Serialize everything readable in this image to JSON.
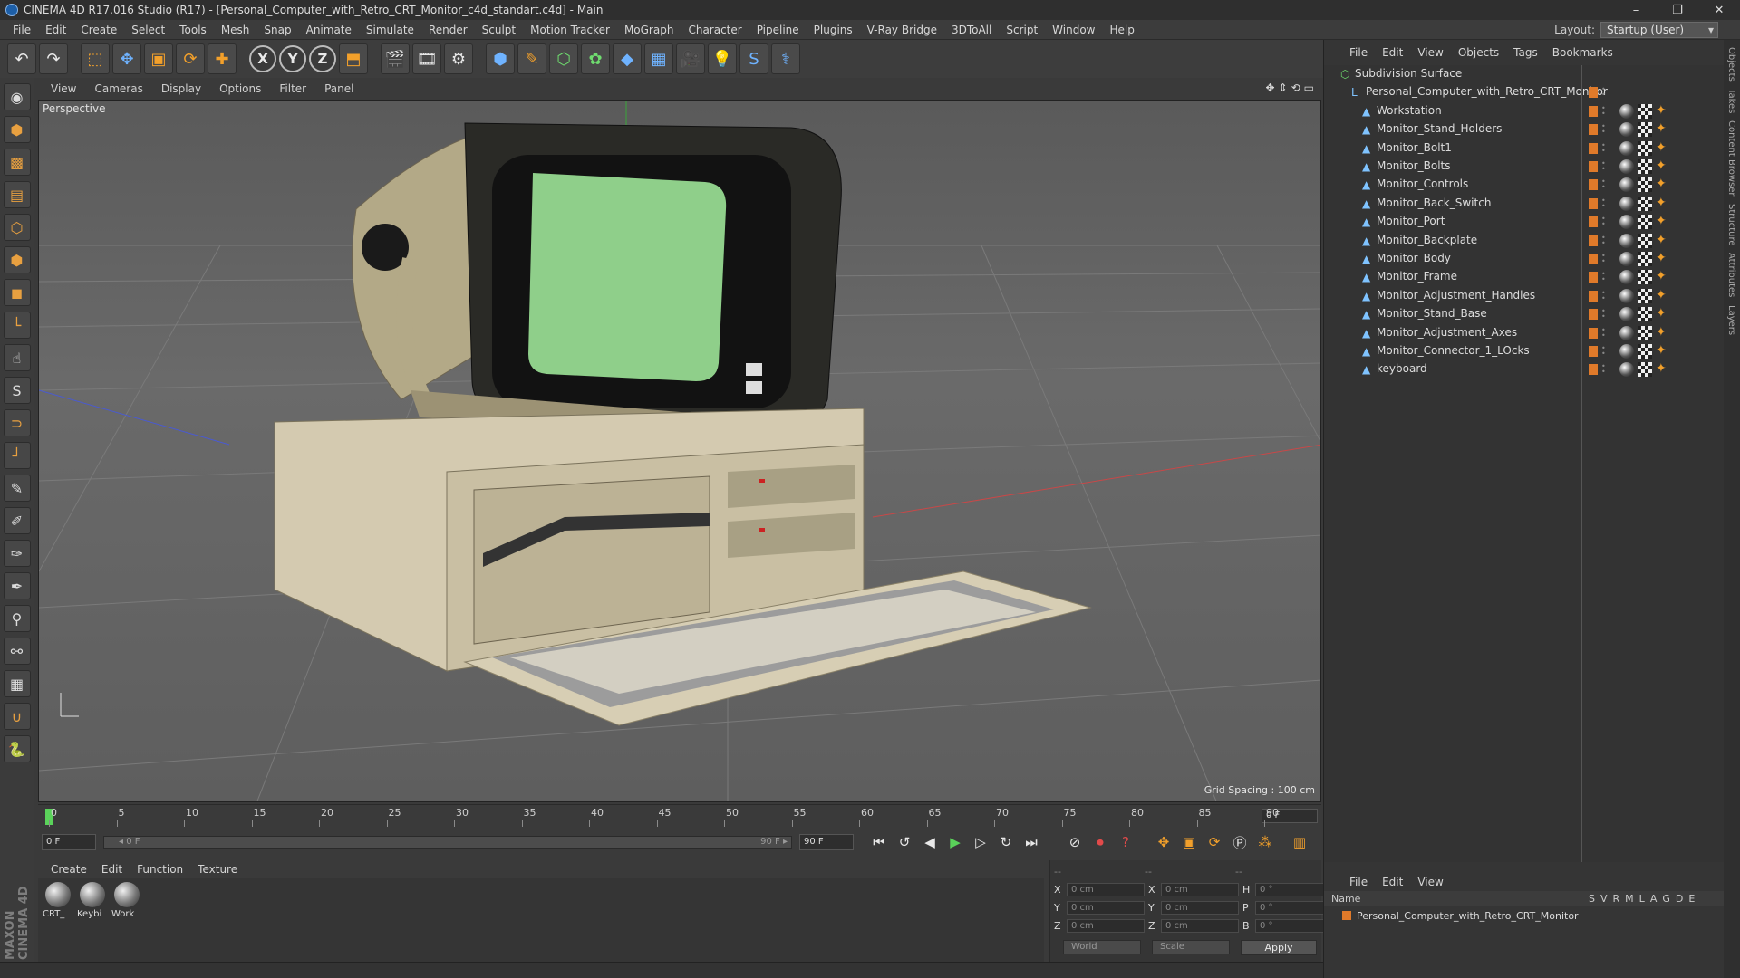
{
  "window": {
    "title": "CINEMA 4D R17.016 Studio (R17) - [Personal_Computer_with_Retro_CRT_Monitor_c4d_standart.c4d] - Main",
    "controls": [
      "–",
      "❐",
      "✕"
    ]
  },
  "menubar": [
    "File",
    "Edit",
    "Create",
    "Select",
    "Tools",
    "Mesh",
    "Snap",
    "Animate",
    "Simulate",
    "Render",
    "Sculpt",
    "Motion Tracker",
    "MoGraph",
    "Character",
    "Pipeline",
    "Plugins",
    "V-Ray Bridge",
    "3DToAll",
    "Script",
    "Window",
    "Help"
  ],
  "layout": {
    "label": "Layout:",
    "value": "Startup (User)"
  },
  "toolbar": {
    "icons": [
      "undo-icon",
      "redo-icon",
      "live-selection-icon",
      "move-icon",
      "scale-icon",
      "rotate-icon",
      "recent-tool-icon",
      "x-axis-icon",
      "y-axis-icon",
      "z-axis-icon",
      "coordinate-system-icon",
      "render-view-icon",
      "render-picture-viewer-icon",
      "edit-render-settings-icon",
      "cube-icon",
      "pen-spline-icon",
      "subdivision-surface-icon",
      "cloner-icon",
      "deformer-icon",
      "floor-icon",
      "camera-icon",
      "light-icon",
      "python-icon",
      "script-icon"
    ],
    "axis_labels": [
      "X",
      "Y",
      "Z"
    ]
  },
  "viewport": {
    "menu": [
      "View",
      "Cameras",
      "Display",
      "Options",
      "Filter",
      "Panel"
    ],
    "label": "Perspective",
    "grid_spacing": "Grid Spacing : 100 cm"
  },
  "timeline": {
    "ticks": [
      "0",
      "5",
      "10",
      "15",
      "20",
      "25",
      "30",
      "35",
      "40",
      "45",
      "50",
      "55",
      "60",
      "65",
      "70",
      "75",
      "80",
      "85",
      "90"
    ],
    "current_frame": "0 F"
  },
  "transport": {
    "start": "0 F",
    "slider_left": "◂ 0 F",
    "slider_right": "90 F ▸",
    "end": "90 F"
  },
  "materials": {
    "menu": [
      "Create",
      "Edit",
      "Function",
      "Texture"
    ],
    "items": [
      "CRT_",
      "Keybi",
      "Work"
    ]
  },
  "coordinates": {
    "header": [
      "--",
      "--",
      "--"
    ],
    "rows": [
      {
        "a": "X",
        "av": "0 cm",
        "b": "X",
        "bv": "0 cm",
        "c": "H",
        "cv": "0 °"
      },
      {
        "a": "Y",
        "av": "0 cm",
        "b": "Y",
        "bv": "0 cm",
        "c": "P",
        "cv": "0 °"
      },
      {
        "a": "Z",
        "av": "0 cm",
        "b": "Z",
        "bv": "0 cm",
        "c": "B",
        "cv": "0 °"
      }
    ],
    "world": "World",
    "scale": "Scale",
    "apply": "Apply"
  },
  "objects": {
    "menu": [
      "File",
      "Edit",
      "View",
      "Objects",
      "Tags",
      "Bookmarks"
    ],
    "tree": [
      {
        "name": "Subdivision Surface",
        "level": 0
      },
      {
        "name": "Personal_Computer_with_Retro_CRT_Monitor",
        "level": 1
      },
      {
        "name": "Workstation",
        "level": 2
      },
      {
        "name": "Monitor_Stand_Holders",
        "level": 2
      },
      {
        "name": "Monitor_Bolt1",
        "level": 2
      },
      {
        "name": "Monitor_Bolts",
        "level": 2
      },
      {
        "name": "Monitor_Controls",
        "level": 2
      },
      {
        "name": "Monitor_Back_Switch",
        "level": 2
      },
      {
        "name": "Monitor_Port",
        "level": 2
      },
      {
        "name": "Monitor_Backplate",
        "level": 2
      },
      {
        "name": "Monitor_Body",
        "level": 2
      },
      {
        "name": "Monitor_Frame",
        "level": 2
      },
      {
        "name": "Monitor_Adjustment_Handles",
        "level": 2
      },
      {
        "name": "Monitor_Stand_Base",
        "level": 2
      },
      {
        "name": "Monitor_Adjustment_Axes",
        "level": 2
      },
      {
        "name": "Monitor_Connector_1_LOcks",
        "level": 2
      },
      {
        "name": "keyboard",
        "level": 2
      }
    ]
  },
  "layers": {
    "menu": [
      "File",
      "Edit",
      "View"
    ],
    "name_header": "Name",
    "cols": [
      "S",
      "V",
      "R",
      "M",
      "L",
      "A",
      "G",
      "D",
      "E"
    ],
    "row": "Personal_Computer_with_Retro_CRT_Monitor"
  },
  "side_tabs": [
    "Objects",
    "Takes",
    "Content Browser",
    "Structure",
    "Attributes",
    "Layers"
  ],
  "brand": "MAXON CINEMA 4D",
  "colors": {
    "accent": "#f2a02b",
    "layer": "#e07a2a",
    "screen": "#8fcf8a",
    "playhead": "#5ad25a"
  }
}
